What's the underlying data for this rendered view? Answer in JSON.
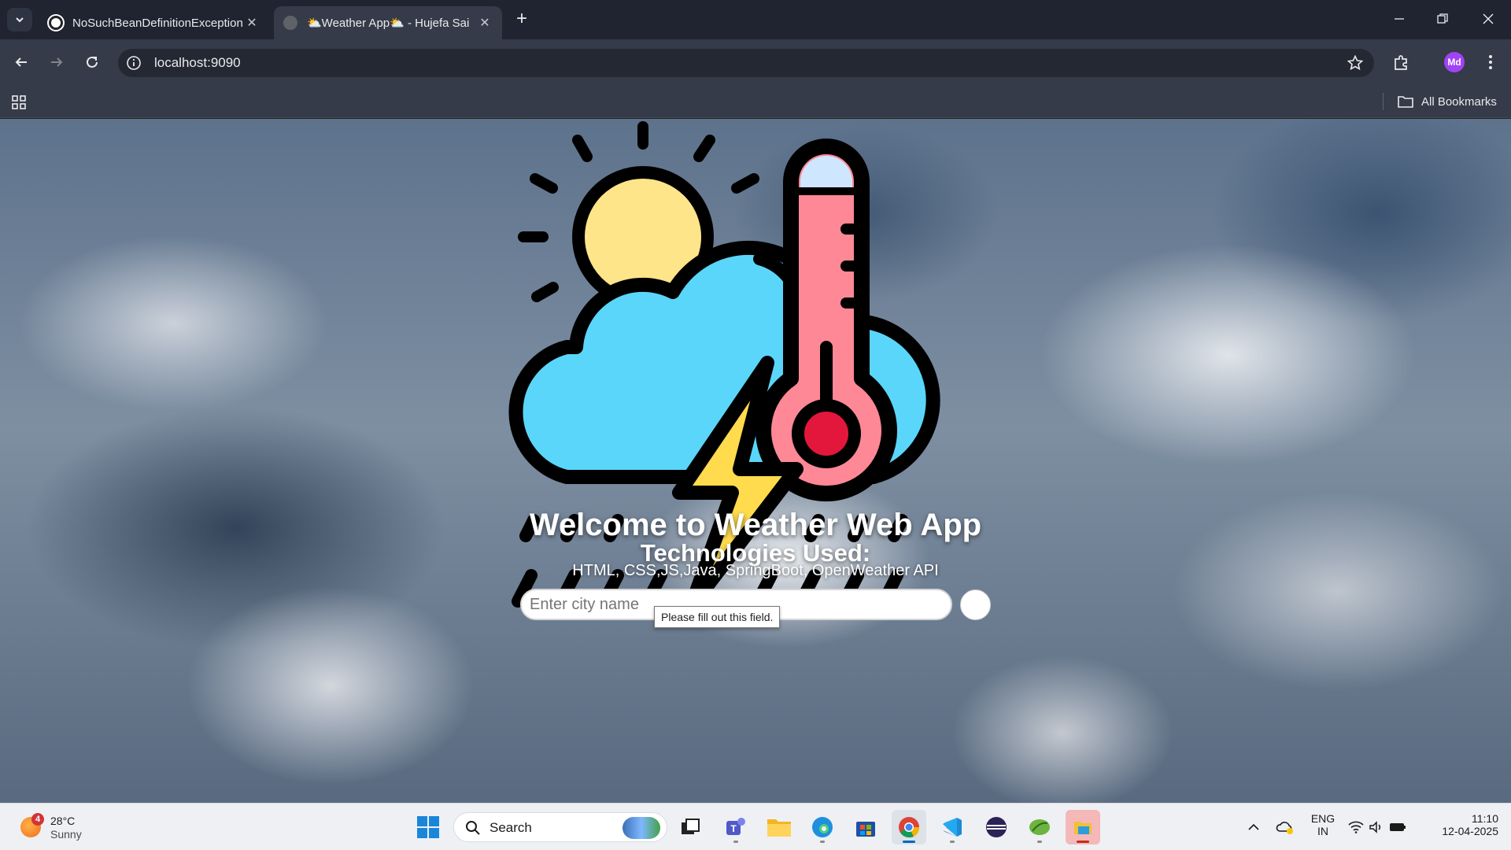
{
  "browser": {
    "tabs": [
      {
        "title": "NoSuchBeanDefinitionException",
        "active": false
      },
      {
        "title": "⛅Weather App⛅ - Hujefa Sai",
        "active": true
      }
    ],
    "url": "localhost:9090",
    "profile_initials": "Md",
    "bookmarks_label": "All Bookmarks"
  },
  "page": {
    "welcome": "Welcome to Weather Web App",
    "tech_title": "Technologies Used:",
    "tech_list": "HTML, CSS,JS,Java, SpringBoot, OpenWeather API",
    "city_placeholder": "Enter city name",
    "validation_tooltip": "Please fill out this field."
  },
  "taskbar": {
    "weather": {
      "temp": "28°C",
      "condition": "Sunny",
      "badge": "4"
    },
    "search_label": "Search",
    "apps": [
      "task-view",
      "teams",
      "file-explorer",
      "edge",
      "microsoft-store",
      "chrome",
      "vscode",
      "eclipse",
      "spring-tools",
      "files"
    ],
    "language": {
      "lang": "ENG",
      "region": "IN"
    },
    "clock": {
      "time": "11:10",
      "date": "12-04-2025"
    }
  },
  "colors": {
    "cloud": "#5ad6fa",
    "sun": "#ffe58a",
    "thermometer": "#ff8896",
    "bolt": "#ffdb4d",
    "accent": "#0067c0"
  }
}
